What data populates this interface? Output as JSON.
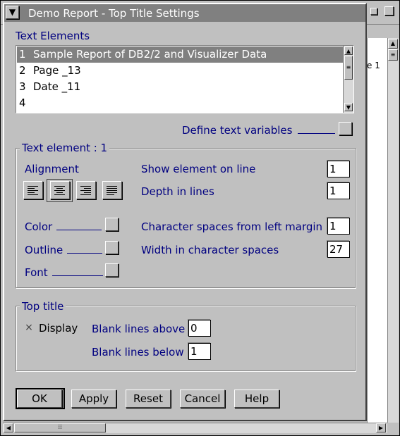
{
  "window": {
    "title": "Demo Report - Top Title Settings"
  },
  "background": {
    "label_fragment": "e 1"
  },
  "text_elements": {
    "heading": "Text Elements",
    "items": [
      {
        "num": "1",
        "text": "Sample Report of DB2/2 and Visualizer Data",
        "selected": true
      },
      {
        "num": "2",
        "text": "Page _13",
        "selected": false
      },
      {
        "num": "3",
        "text": "Date _11",
        "selected": false
      },
      {
        "num": "4",
        "text": "",
        "selected": false
      }
    ],
    "define_variables_label": "Define text variables"
  },
  "text_element_group": {
    "title": "Text element : 1",
    "alignment_label": "Alignment",
    "color_label": "Color",
    "outline_label": "Outline",
    "font_label": "Font",
    "show_on_line_label": "Show element on line",
    "show_on_line_value": "1",
    "depth_label": "Depth in lines",
    "depth_value": "1",
    "char_spaces_label": "Character spaces from left margin",
    "char_spaces_value": "1",
    "width_label": "Width in character spaces",
    "width_value": "27"
  },
  "top_title_group": {
    "title": "Top title",
    "display_label": "Display",
    "display_checked": true,
    "check_mark": "×",
    "blank_above_label": "Blank lines above",
    "blank_above_value": "0",
    "blank_below_label": "Blank lines below",
    "blank_below_value": "1"
  },
  "buttons": {
    "ok": "OK",
    "apply": "Apply",
    "reset": "Reset",
    "cancel": "Cancel",
    "help": "Help"
  },
  "colors": {
    "title_bar": "#808080",
    "label_text": "#000080",
    "selection": "#808080"
  }
}
